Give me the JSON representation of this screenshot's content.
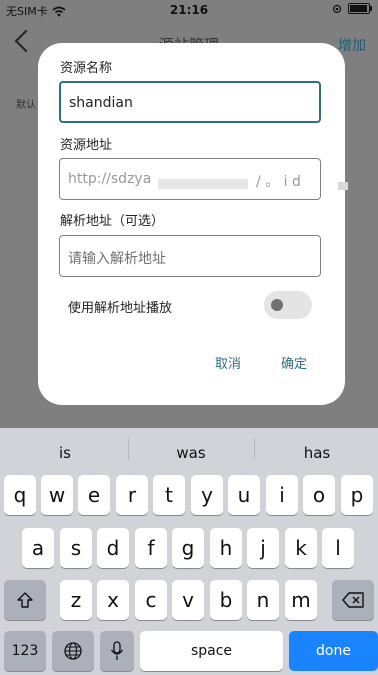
{
  "status_bar": {
    "carrier": "无SIM卡",
    "time": "21:16"
  },
  "header": {
    "title": "源站管理",
    "add_label": "增加"
  },
  "background": {
    "default_label": "默认"
  },
  "dialog": {
    "name_label": "资源名称",
    "name_value": "shandian",
    "address_label": "资源地址",
    "address_value": "http://sdzya",
    "address_value_tail": "/ 。 i d",
    "parse_label": "解析地址（可选）",
    "parse_placeholder": "请输入解析地址",
    "toggle_label": "使用解析地址播放",
    "toggle_on": false,
    "cancel_label": "取消",
    "confirm_label": "确定"
  },
  "keyboard": {
    "suggestions": [
      "is",
      "was",
      "has"
    ],
    "row1": [
      "q",
      "w",
      "e",
      "r",
      "t",
      "y",
      "u",
      "i",
      "o",
      "p"
    ],
    "row2": [
      "a",
      "s",
      "d",
      "f",
      "g",
      "h",
      "j",
      "k",
      "l"
    ],
    "row3": [
      "z",
      "x",
      "c",
      "v",
      "b",
      "n",
      "m"
    ],
    "numbers_label": "123",
    "space_label": "space",
    "done_label": "done"
  },
  "colors": {
    "accent": "#2f6f80",
    "done_key": "#1a84ff"
  }
}
